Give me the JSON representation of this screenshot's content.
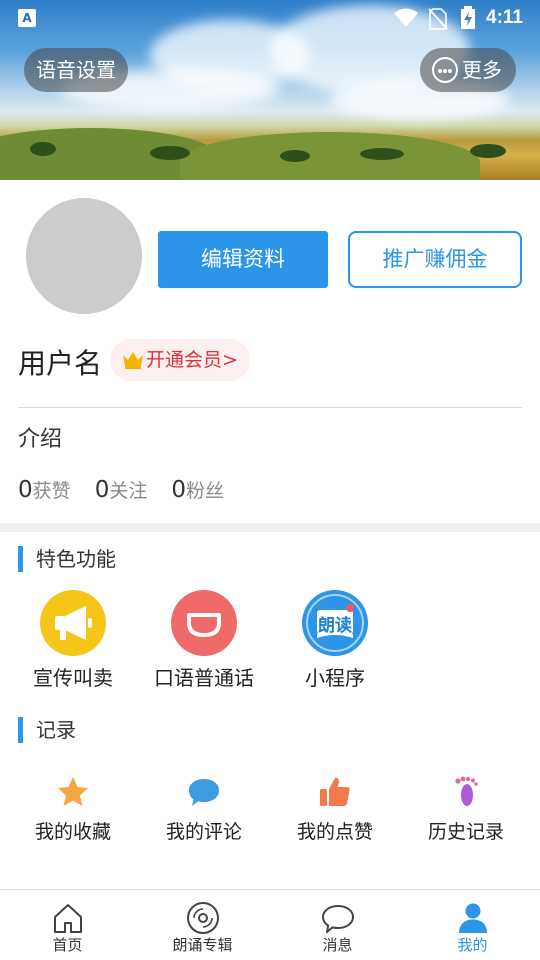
{
  "status_bar": {
    "time": "4:11",
    "app_icon_letter": "A"
  },
  "header": {
    "voice_settings_label": "语音设置",
    "more_label": "更多"
  },
  "profile": {
    "edit_button_label": "编辑资料",
    "promo_button_label": "推广赚佣金",
    "username": "用户名",
    "vip_label": "开通会员>",
    "intro_label": "介绍",
    "stats": [
      {
        "count": "0",
        "label": "获赞"
      },
      {
        "count": "0",
        "label": "关注"
      },
      {
        "count": "0",
        "label": "粉丝"
      }
    ]
  },
  "features": {
    "title": "特色功能",
    "items": [
      {
        "label": "宣传叫卖",
        "icon": "megaphone-icon",
        "color": "#f5c518"
      },
      {
        "label": "口语普通话",
        "icon": "mouth-icon",
        "color": "#f06a6a"
      },
      {
        "label": "小程序",
        "icon": "book-read-icon",
        "icon_text": "朗读",
        "color": "#2b95e9"
      }
    ]
  },
  "records": {
    "title": "记录",
    "items": [
      {
        "label": "我的收藏",
        "icon": "star-icon",
        "color": "#f5a742"
      },
      {
        "label": "我的评论",
        "icon": "comment-icon",
        "color": "#3d9be0"
      },
      {
        "label": "我的点赞",
        "icon": "thumbs-up-icon",
        "color": "#f27a4c"
      },
      {
        "label": "历史记录",
        "icon": "footprint-icon",
        "color": "#b05bd6"
      }
    ]
  },
  "bottom_nav": {
    "items": [
      {
        "label": "首页",
        "icon": "home-icon",
        "active": false
      },
      {
        "label": "朗诵专辑",
        "icon": "disc-icon",
        "active": false
      },
      {
        "label": "消息",
        "icon": "message-icon",
        "active": false
      },
      {
        "label": "我的",
        "icon": "person-icon",
        "active": true
      }
    ],
    "active_color": "#2b95e9"
  }
}
